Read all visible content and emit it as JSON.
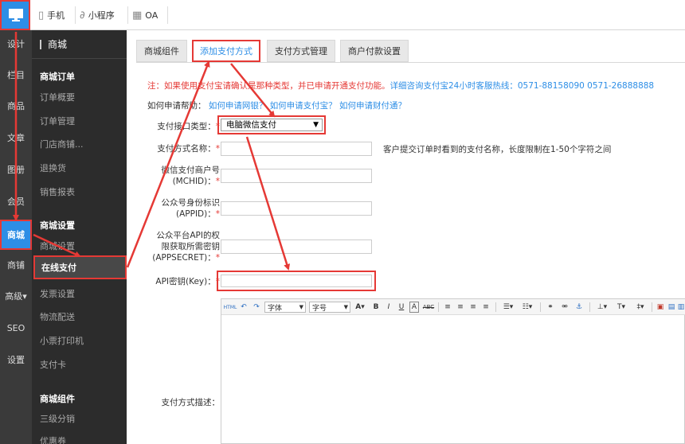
{
  "topbar": {
    "items": [
      {
        "label": "手机",
        "icon": "phone-icon"
      },
      {
        "label": "小程序",
        "icon": "link-icon"
      },
      {
        "label": "OA",
        "icon": "calendar-icon"
      }
    ]
  },
  "iconbar": {
    "items": [
      "设计",
      "栏目",
      "商品",
      "文章",
      "图册",
      "会员",
      "商城",
      "商铺",
      "高级▾",
      "SEO",
      "设置"
    ],
    "active": "商城"
  },
  "submenu": {
    "head": "商城",
    "groups": [
      {
        "title": "商城订单",
        "items": [
          "订单概要",
          "订单管理",
          "门店商铺...",
          "退换货",
          "销售报表"
        ]
      },
      {
        "title": "商城设置",
        "items": [
          "商城设置",
          "在线支付",
          "发票设置",
          "物流配送",
          "小票打印机",
          "支付卡"
        ]
      },
      {
        "title": "商城组件",
        "items": [
          "三级分销",
          "优惠券"
        ]
      }
    ],
    "selected": "在线支付"
  },
  "tabs": [
    "商城组件",
    "添加支付方式",
    "支付方式管理",
    "商户付款设置"
  ],
  "active_tab": "添加支付方式",
  "notice": {
    "red": "注：如果使用支付宝请确认是那种类型，并已申请开通支付功能。",
    "blue": "详细咨询支付宝24小时客服热线：0571-88158090 0571-26888888"
  },
  "help": {
    "prefix": "如何申请帮助：",
    "links": [
      "如何申请网银？",
      "如何申请支付宝？",
      "如何申请财付通？"
    ]
  },
  "form": {
    "payment_type_label": "支付接口类型：",
    "payment_type_value": "电脑微信支付",
    "name_label": "支付方式名称：",
    "name_hint": "客户提交订单时看到的支付名称，长度限制在1-50个字符之间",
    "mchid_label_1": "微信支付商户号",
    "mchid_label_2": "(MCHID)：",
    "appid_label_1": "公众号身份标识",
    "appid_label_2": "(APPID)：",
    "appsecret_label_1": "公众平台API的权",
    "appsecret_label_2": "限获取所需密钥",
    "appsecret_label_3": "(APPSECRET)：",
    "apikey_label": "API密钥(Key)：",
    "desc_label": "支付方式描述：",
    "required_mark": "*"
  },
  "editor": {
    "font_select": "字体",
    "size_select": "字号",
    "html_button": "HTML"
  }
}
